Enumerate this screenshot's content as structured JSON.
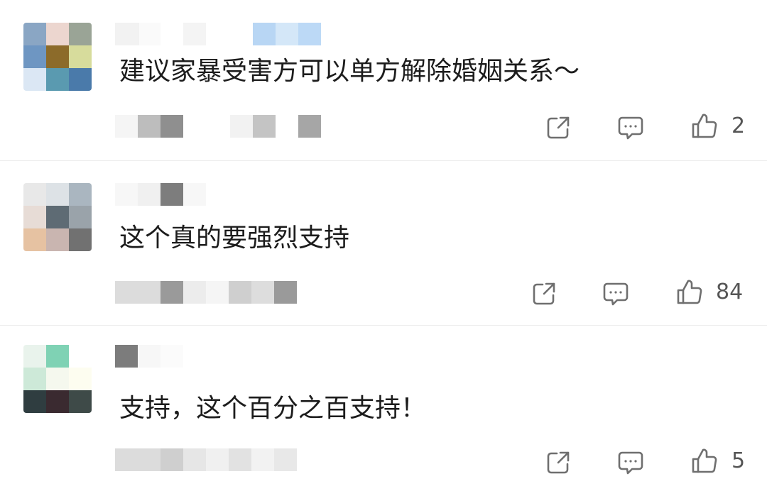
{
  "comments": [
    {
      "text": "建议家暴受害方可以单方解除婚姻关系～",
      "like_count": "2",
      "avatar_pixels": [
        "#8aa6c4",
        "#ecd6cf",
        "#9aa496",
        "#6e96c2",
        "#8c6b2a",
        "#d7dc9c",
        "#dbe7f4",
        "#5a9ab0",
        "#4a7aaa"
      ]
    },
    {
      "text": "这个真的要强烈支持",
      "like_count": "84",
      "avatar_pixels": [
        "#e8e8e8",
        "#dde2e6",
        "#aab6c0",
        "#e7dcd6",
        "#5e6b74",
        "#9aa3aa",
        "#e6c2a2",
        "#c9b5b0",
        "#717171"
      ]
    },
    {
      "text": "支持，这个百分之百支持！",
      "like_count": "5",
      "avatar_pixels": [
        "#e9f3ec",
        "#7fd2b4",
        "#ffffff",
        "#cde9d8",
        "#f5f8ee",
        "#fdfdf0",
        "#2f3d40",
        "#3a2a30",
        "#3e4a48"
      ]
    }
  ],
  "icons": {
    "share": "share-icon",
    "reply": "comment-bubble-icon",
    "like": "thumbs-up-icon"
  },
  "colors": {
    "text": "#1c1c1c",
    "icon": "#6f6f6f",
    "count": "#555555",
    "divider": "#ececec"
  }
}
